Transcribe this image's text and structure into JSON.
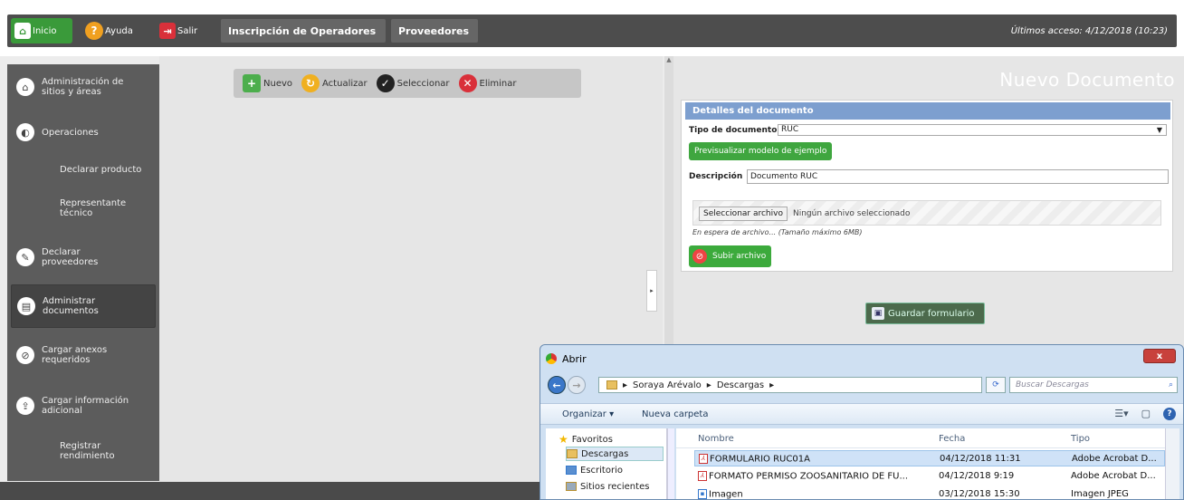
{
  "navbar": {
    "inicio": "Inicio",
    "ayuda": "Ayuda",
    "salir": "Salir",
    "tab_inscripcion": "Inscripción de Operadores",
    "tab_proveedores": "Proveedores",
    "last_access": "Últimos acceso: 4/12/2018 (10:23)"
  },
  "sidebar": {
    "items": [
      {
        "label1": "Administración de",
        "label2": "sitios y áreas"
      },
      {
        "label1": "Operaciones",
        "label2": ""
      },
      {
        "label1": "Declarar producto",
        "label2": ""
      },
      {
        "label1": "Representante",
        "label2": "técnico"
      },
      {
        "label1": "Declarar",
        "label2": "proveedores"
      },
      {
        "label1": "Administrar",
        "label2": "documentos"
      },
      {
        "label1": "Cargar anexos",
        "label2": "requeridos"
      },
      {
        "label1": "Cargar información",
        "label2": "adicional"
      },
      {
        "label1": "Registrar",
        "label2": "rendimiento"
      }
    ]
  },
  "toolbar": {
    "nuevo": "Nuevo",
    "actualizar": "Actualizar",
    "seleccionar": "Seleccionar",
    "eliminar": "Eliminar"
  },
  "form": {
    "page_title": "Nuevo Documento",
    "panel_title": "Detalles del documento",
    "tipo_label": "Tipo de documento",
    "tipo_value": "RUC",
    "preview_button": "Previsualizar modelo de ejemplo",
    "desc_label": "Descripción",
    "desc_value": "Documento RUC",
    "file_button": "Seleccionar archivo",
    "file_status": "Ningún archivo seleccionado",
    "waiting": "En espera de archivo... (Tamaño máximo 6MB)",
    "upload_button": "Subir archivo",
    "save_button": "Guardar formulario"
  },
  "dialog": {
    "title": "Abrir",
    "path1": "Soraya Arévalo",
    "path2": "Descargas",
    "search_placeholder": "Buscar Descargas",
    "organizar": "Organizar ▾",
    "nueva_carpeta": "Nueva carpeta",
    "nav": [
      {
        "label": "Favoritos"
      },
      {
        "label": "Descargas"
      },
      {
        "label": "Escritorio"
      },
      {
        "label": "Sitios recientes"
      }
    ],
    "columns": {
      "nombre": "Nombre",
      "fecha": "Fecha",
      "tipo": "Tipo"
    },
    "files": [
      {
        "name": "FORMULARIO RUC01A",
        "date": "04/12/2018 11:31",
        "type": "Adobe Acrobat D..."
      },
      {
        "name": "FORMATO PERMISO ZOOSANITARIO DE FU...",
        "date": "04/12/2018 9:19",
        "type": "Adobe Acrobat D..."
      },
      {
        "name": "Imagen",
        "date": "03/12/2018 15:30",
        "type": "Imagen JPEG"
      }
    ]
  },
  "colors": {
    "accent_green": "#3fa63f",
    "panel_blue": "#7d9fcf",
    "nav_dark": "#4d4d4d"
  }
}
